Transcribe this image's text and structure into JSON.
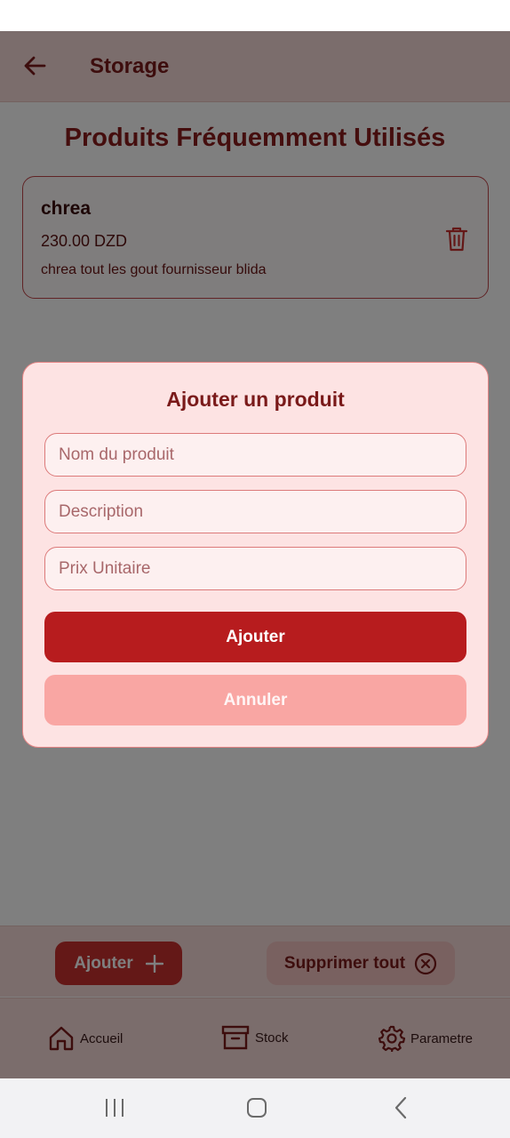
{
  "app_bar": {
    "title": "Storage"
  },
  "page": {
    "title": "Produits Fréquemment Utilisés"
  },
  "products": [
    {
      "name": "chrea",
      "price": "230.00 DZD",
      "description": "chrea tout les gout fournisseur blida"
    }
  ],
  "dialog": {
    "title": "Ajouter un produit",
    "fields": {
      "name_placeholder": "Nom du produit",
      "description_placeholder": "Description",
      "price_placeholder": "Prix Unitaire"
    },
    "confirm_label": "Ajouter",
    "cancel_label": "Annuler"
  },
  "actions": {
    "add_label": "Ajouter",
    "delete_all_label": "Supprimer tout"
  },
  "bottom_nav": [
    {
      "label": "Accueil",
      "icon": "home-icon"
    },
    {
      "label": "Stock",
      "icon": "archive-icon"
    },
    {
      "label": "Parametre",
      "icon": "gear-icon"
    }
  ],
  "colors": {
    "primary": "#b71c1e",
    "primary_light": "#f9a6a3",
    "dialog_bg": "#fde3e3",
    "title_text": "#8a1c1c"
  }
}
